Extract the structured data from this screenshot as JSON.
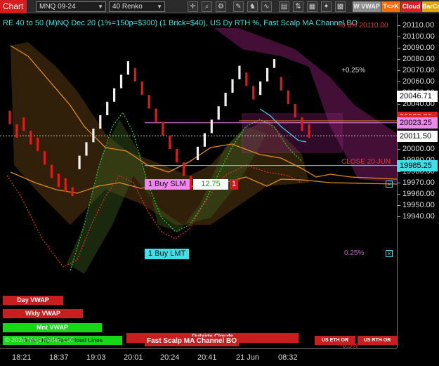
{
  "toolbar": {
    "chart_label": "Chart",
    "instrument": "MNQ 09-24",
    "period": "40 Renko",
    "icons": [
      "crosshair-icon",
      "zoom-icon",
      "properties-icon",
      "drawing-icon",
      "strategy-icon",
      "indicator-icon",
      "data-box-icon",
      "chart-trader-icon",
      "template-icon"
    ],
    "buttons": [
      {
        "label": "W VWAP",
        "color": "#8c8c8c",
        "text_color": "#eeeeee"
      },
      {
        "label": "T<>K",
        "color": "#ff6a00",
        "text_color": "#ffffff"
      },
      {
        "label": "Cloud",
        "color": "#e21e1e",
        "text_color": "#ffffff"
      },
      {
        "label": "BarCo",
        "color": "#e3a400",
        "text_color": "#ffffff"
      }
    ]
  },
  "chart_title": "RE 40 to 50 (M)NQ Dec 20 (1%=150p=$300) (1 Brick=$40), US Dy RTH %, Fast Scalp MA Channel BO",
  "annotations": {
    "top_pct": "+0.5% 20110.00",
    "plus_025": "+0.25%",
    "close_label": "CLOSE 20 JUN",
    "minus_025": "0.25%",
    "minus_05": "-0.5%"
  },
  "yaxis": {
    "ticks": [
      "20110.00",
      "20100.00",
      "20090.00",
      "20080.00",
      "20070.00",
      "20060.00",
      "20050.00",
      "20040.00",
      "20030.00",
      "20020.00",
      "20010.00",
      "20000.00",
      "19990.00",
      "19980.00",
      "19970.00",
      "19960.00",
      "19950.00",
      "19940.00"
    ],
    "tags": [
      {
        "label": "20046.71",
        "bg": "#ffffff",
        "fg": "#000000"
      },
      {
        "label": "20028.00",
        "bg": "#e21e1e",
        "fg": "#ffffff"
      },
      {
        "label": "20025.00",
        "bg": "#e21e1e",
        "fg": "#ffffff"
      },
      {
        "label": "20023.25",
        "bg": "#ee88ee",
        "fg": "#000000"
      },
      {
        "label": "20011.50",
        "bg": "#ffffff",
        "fg": "#000000"
      },
      {
        "label": "19985.25",
        "bg": "#40e0e8",
        "fg": "#000000"
      }
    ]
  },
  "xaxis": {
    "ticks": [
      "18:21",
      "18:37",
      "19:03",
      "20:01",
      "20:24",
      "20:41",
      "21 Jun",
      "08:32"
    ]
  },
  "orders": {
    "stop": {
      "label": "1 Buy SLM",
      "qty_label": "12.75",
      "count": "1",
      "color": "#ee88ee"
    },
    "limit": {
      "label": "1 Buy LMT",
      "color": "#40e0e8"
    }
  },
  "boxes": {
    "day_vwap": "Day VWAP",
    "wkly_vwap": "Wkly VWAP",
    "mnt_vwap": "Mnt VWAP",
    "renko_lines": "TenkanKijun Fast Cloud Lines",
    "outside_clouds": "Outside Clouds",
    "fast_scalp": "Fast Scalp MA Channel BO",
    "us_eth_or": "US ETH OR",
    "us_rth_or": "US RTH OR"
  },
  "copyright": "© 2024 NinjaTrader, LLC",
  "chart_data": {
    "type": "candlestick",
    "title": "RE 40 to 50 (M)NQ Dec 20 (1%=150p=$300) (1 Brick=$40), US Dy RTH %, Fast Scalp MA Channel BO",
    "ylim": [
      19937,
      20117
    ],
    "x_ticks": [
      "18:21",
      "18:37",
      "19:03",
      "20:01",
      "20:24",
      "20:41",
      "21 Jun",
      "08:32"
    ],
    "bricks": [
      {
        "d": "down",
        "o": 20034,
        "c": 20022
      },
      {
        "d": "down",
        "o": 20022,
        "c": 20010
      },
      {
        "d": "down",
        "o": 20028,
        "c": 20016
      },
      {
        "d": "down",
        "o": 20016,
        "c": 20004
      },
      {
        "d": "down",
        "o": 20010,
        "c": 19998
      },
      {
        "d": "down",
        "o": 19998,
        "c": 19986
      },
      {
        "d": "down",
        "o": 19986,
        "c": 19974
      },
      {
        "d": "down",
        "o": 19978,
        "c": 19966
      },
      {
        "d": "down",
        "o": 19974,
        "c": 19962
      },
      {
        "d": "down",
        "o": 19966,
        "c": 19958
      },
      {
        "d": "up",
        "o": 19982,
        "c": 19994
      },
      {
        "d": "up",
        "o": 19994,
        "c": 20006
      },
      {
        "d": "up",
        "o": 20006,
        "c": 20018
      },
      {
        "d": "up",
        "o": 20018,
        "c": 20030
      },
      {
        "d": "up",
        "o": 20030,
        "c": 20042
      },
      {
        "d": "up",
        "o": 20042,
        "c": 20054
      },
      {
        "d": "up",
        "o": 20054,
        "c": 20066
      },
      {
        "d": "up",
        "o": 20066,
        "c": 20078
      },
      {
        "d": "down",
        "o": 20072,
        "c": 20060
      },
      {
        "d": "down",
        "o": 20060,
        "c": 20048
      },
      {
        "d": "down",
        "o": 20048,
        "c": 20036
      },
      {
        "d": "down",
        "o": 20036,
        "c": 20024
      },
      {
        "d": "down",
        "o": 20024,
        "c": 20012
      },
      {
        "d": "down",
        "o": 20012,
        "c": 20000
      },
      {
        "d": "down",
        "o": 20000,
        "c": 19988
      },
      {
        "d": "down",
        "o": 19988,
        "c": 19976
      },
      {
        "d": "down",
        "o": 19976,
        "c": 19964
      },
      {
        "d": "up",
        "o": 19990,
        "c": 20002
      },
      {
        "d": "up",
        "o": 20002,
        "c": 20014
      },
      {
        "d": "up",
        "o": 20014,
        "c": 20026
      },
      {
        "d": "up",
        "o": 20026,
        "c": 20038
      },
      {
        "d": "up",
        "o": 20038,
        "c": 20050
      },
      {
        "d": "up",
        "o": 20050,
        "c": 20062
      },
      {
        "d": "up",
        "o": 20062,
        "c": 20074
      },
      {
        "d": "down",
        "o": 20068,
        "c": 20056
      },
      {
        "d": "down",
        "o": 20056,
        "c": 20044
      },
      {
        "d": "up",
        "o": 20048,
        "c": 20060
      },
      {
        "d": "up",
        "o": 20060,
        "c": 20072
      },
      {
        "d": "up",
        "o": 20072,
        "c": 20080
      },
      {
        "d": "down",
        "o": 20064,
        "c": 20052
      },
      {
        "d": "down",
        "o": 20052,
        "c": 20040
      },
      {
        "d": "down",
        "o": 20040,
        "c": 20028
      },
      {
        "d": "down",
        "o": 20028,
        "c": 20016
      },
      {
        "d": "down",
        "o": 20022,
        "c": 20010
      }
    ]
  }
}
